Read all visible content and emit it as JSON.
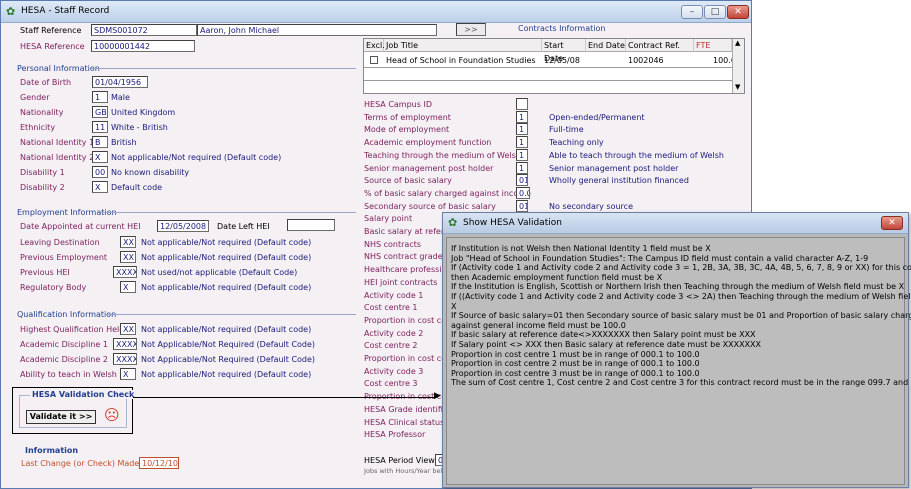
{
  "window": {
    "title": "HESA - Staff Record"
  },
  "header": {
    "staff_ref_label": "Staff Reference",
    "staff_ref": "SDMS001072",
    "staff_name": "Aaron, John Michael",
    "nav_button": ">>",
    "hesa_ref_label": "HESA Reference",
    "hesa_ref": "10000001442"
  },
  "personal": {
    "title": "Personal Information",
    "rows": [
      {
        "label": "Date of Birth",
        "code": "01/04/1956",
        "desc": ""
      },
      {
        "label": "Gender",
        "code": "1",
        "desc": "Male"
      },
      {
        "label": "Nationality",
        "code": "GB",
        "desc": "United Kingdom"
      },
      {
        "label": "Ethnicity",
        "code": "11",
        "desc": "White - British"
      },
      {
        "label": "National Identity 1",
        "code": "B",
        "desc": "British"
      },
      {
        "label": "National Identity 2",
        "code": "X",
        "desc": "Not applicable/Not required (Default code)"
      },
      {
        "label": "Disability 1",
        "code": "00",
        "desc": "No known disability"
      },
      {
        "label": "Disability 2",
        "code": "X",
        "desc": "Default code"
      }
    ]
  },
  "employment": {
    "title": "Employment Information",
    "appointed_label": "Date Appointed at current HEI",
    "appointed": "12/05/2008",
    "left_label": "Date Left HEI",
    "left": "",
    "rows": [
      {
        "label": "Leaving Destination",
        "code": "XX",
        "desc": "Not applicable/Not required (Default code)"
      },
      {
        "label": "Previous Employment",
        "code": "XX",
        "desc": "Not applicable/Not required (Default code)"
      },
      {
        "label": "Previous HEI",
        "code": "XXXX",
        "desc": "Not used/not applicable (Default Code)"
      },
      {
        "label": "Regulatory Body",
        "code": "X",
        "desc": "Not applicable/Not required (Default code)"
      }
    ]
  },
  "qualification": {
    "title": "Qualification Information",
    "rows": [
      {
        "label": "Highest Qualification Held",
        "code": "XX",
        "desc": "Not applicable/Not required (Default code)"
      },
      {
        "label": "Academic Discipline 1",
        "code": "XXXX",
        "desc": "Not Applicable/Not Required (Default Code)"
      },
      {
        "label": "Academic Discipline 2",
        "code": "XXXX",
        "desc": "Not Applicable/Not Required (Default Code)"
      },
      {
        "label": "Ability to teach in Welsh",
        "code": "X",
        "desc": "Not applicable/Not required (Default code)"
      }
    ]
  },
  "validation": {
    "title": "HESA Validation Check",
    "button": "Validate it >>"
  },
  "info": {
    "title": "Information",
    "last_change_label": "Last Change (or Check) Made on",
    "last_change": "10/12/10"
  },
  "contracts": {
    "title": "Contracts Information",
    "columns": [
      "Excl.",
      "Job Title",
      "Start Date",
      "End Date",
      "Contract Ref.",
      "FTE"
    ],
    "row": {
      "job": "Head of School in Foundation Studies",
      "start": "12/05/08",
      "end": "",
      "ref": "1002046",
      "fte": "100.0"
    }
  },
  "contract_fields": [
    {
      "label": "HESA Campus ID",
      "code": "",
      "desc": ""
    },
    {
      "label": "Terms of employment",
      "code": "1",
      "desc": "Open-ended/Permanent"
    },
    {
      "label": "Mode of employment",
      "code": "1",
      "desc": "Full-time"
    },
    {
      "label": "Academic employment function",
      "code": "1",
      "desc": "Teaching only"
    },
    {
      "label": "Teaching through the medium of Welsh",
      "code": "1",
      "desc": "Able to teach through the medium of Welsh"
    },
    {
      "label": "Senior management post holder",
      "code": "1",
      "desc": "Senior management post holder"
    },
    {
      "label": "Source of basic salary",
      "code": "01",
      "desc": "Wholly general institution financed"
    },
    {
      "label": "% of basic salary charged against income",
      "code": "0.0",
      "desc": ""
    },
    {
      "label": "Secondary source of basic salary",
      "code": "01",
      "desc": "No secondary source"
    },
    {
      "label": "Salary point",
      "code": "",
      "desc": ""
    },
    {
      "label": "Basic salary at reference",
      "code": "",
      "desc": ""
    },
    {
      "label": "NHS contracts",
      "code": "",
      "desc": ""
    },
    {
      "label": "NHS contract grade",
      "code": "",
      "desc": ""
    },
    {
      "label": "Healthcare professional",
      "code": "",
      "desc": ""
    },
    {
      "label": "HEI joint contracts",
      "code": "",
      "desc": ""
    },
    {
      "label": "Activity code 1",
      "code": "",
      "desc": ""
    },
    {
      "label": "Cost centre 1",
      "code": "",
      "desc": ""
    },
    {
      "label": "Proportion in cost centre",
      "code": "",
      "desc": ""
    },
    {
      "label": "Activity code 2",
      "code": "",
      "desc": ""
    },
    {
      "label": "Cost centre 2",
      "code": "",
      "desc": ""
    },
    {
      "label": "Proportion in cost centre",
      "code": "",
      "desc": ""
    },
    {
      "label": "Activity code 3",
      "code": "",
      "desc": ""
    },
    {
      "label": "Cost centre 3",
      "code": "",
      "desc": ""
    },
    {
      "label": "Proportion in cost centre",
      "code": "",
      "desc": ""
    },
    {
      "label": "HESA Grade identifier",
      "code": "",
      "desc": ""
    },
    {
      "label": "HESA Clinical status",
      "code": "",
      "desc": ""
    },
    {
      "label": "HESA Professor",
      "code": "",
      "desc": ""
    }
  ],
  "period": {
    "label": "HESA Period View",
    "value": "01",
    "note": "Jobs with Hours/Year belo"
  },
  "popup": {
    "title": "Show HESA Validation",
    "lines": [
      "If Institution is not Welsh then National  Identity 1 field must be X",
      "Job \"Head of School in Foundation Studies\": The Campus ID field must contain a valid character A-Z, 1-9",
      "If (Activity code 1 and Activity code 2 and Activity code 3 = 1, 2B, 3A, 3B, 3C, 4A, 4B, 5, 6, 7, 8, 9 or XX) for this contract",
      "then Academic employment function field must be X",
      "If the Institution is English, Scottish or Northern Irish then Teaching through the medium of Welsh field must be X",
      "If ((Activity code 1 and Activity code 2 and Activity code 3 <> 2A) then Teaching through the medium of Welsh field must be",
      "X",
      "If Source of basic salary=01 then Secondary source of basic salary must be 01 and Proportion of basic salary charged",
      "against general income field must be 100.0",
      "If basic salary at reference date<>XXXXXXX then Salary point must be XXX",
      "If Salary point <> XXX then Basic salary at reference date must be XXXXXXX",
      "Proportion in cost centre 1 must be in range of 000.1 to 100.0",
      "Proportion in cost centre 2 must be in range of 000.1 to 100.0",
      "Proportion in cost centre 3 must be in range of 000.1 to 100.0",
      "The sum of Cost centre 1, Cost centre 2 and Cost centre 3  for this contract record must be in the range 099.7 and 100.3"
    ]
  }
}
